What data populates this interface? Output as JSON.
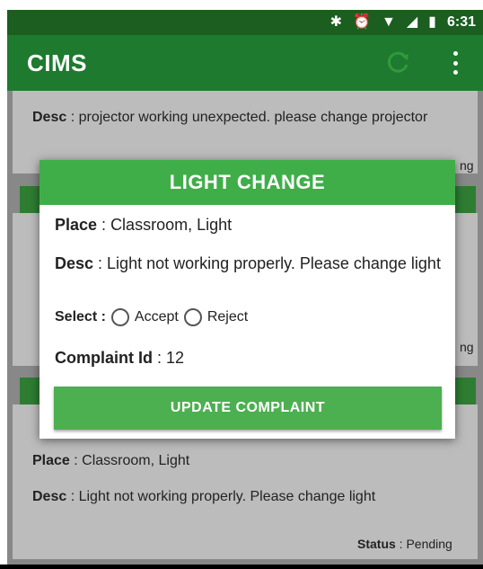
{
  "status_bar": {
    "icons": [
      "bluetooth-icon",
      "alarm-icon",
      "wifi-icon",
      "signal-icon",
      "battery-icon"
    ],
    "time": "6:31"
  },
  "app_bar": {
    "title": "CIMS"
  },
  "list": {
    "card1": {
      "desc_label": "Desc",
      "desc_value": "projector working unexpected. please change projector",
      "status_fragment": "ng"
    },
    "card2": {
      "status_fragment": "ng"
    },
    "card3": {
      "place_label": "Place",
      "place_value": "Classroom, Light",
      "desc_label": "Desc",
      "desc_value": "Light not working properly. Please change light",
      "status_label": "Status",
      "status_value": "Pending"
    }
  },
  "dialog": {
    "title": "LIGHT CHANGE",
    "place_label": "Place",
    "place_value": "Classroom, Light",
    "desc_label": "Desc",
    "desc_value": "Light not working properly. Please change light",
    "select_label": "Select :",
    "accept_label": "Accept",
    "reject_label": "Reject",
    "complaint_label": "Complaint Id",
    "complaint_value": "12",
    "update_button": "UPDATE COMPLAINT"
  },
  "colors": {
    "status_bar": "#1b5e20",
    "app_bar": "#1e7a2e",
    "dialog_header": "#3fae49",
    "button": "#4caf50"
  }
}
